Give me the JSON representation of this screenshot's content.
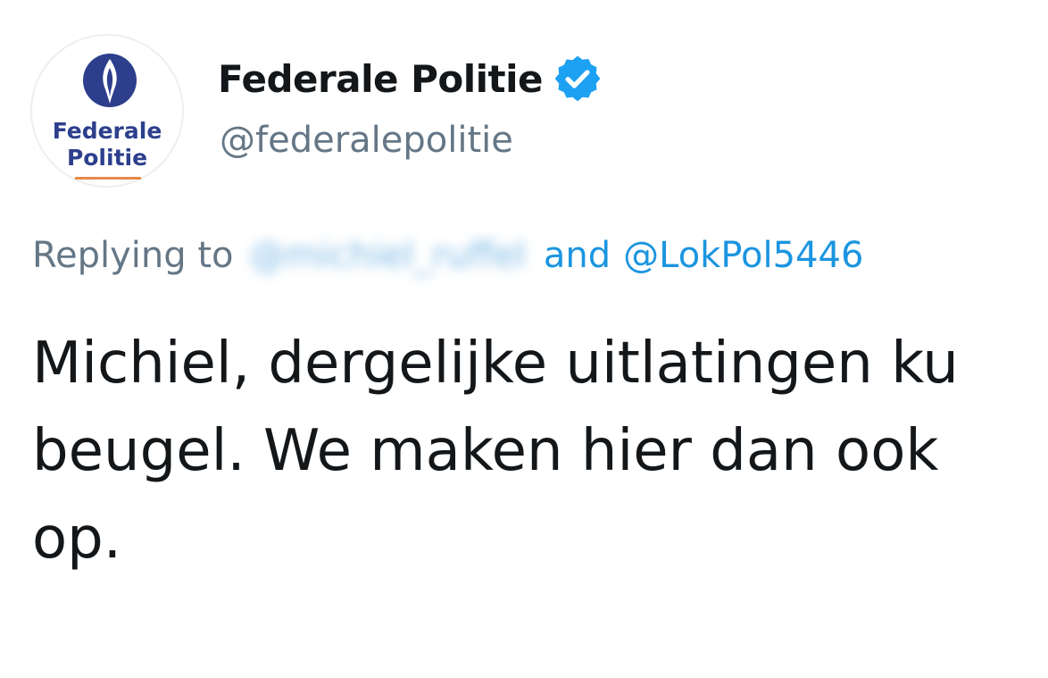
{
  "account": {
    "avatar_text_line1": "Federale",
    "avatar_text_line2": "Politie",
    "display_name": "Federale Politie",
    "handle": "@federalepolitie",
    "verified": true
  },
  "reply": {
    "prefix": "Replying to",
    "blurred_mention": "@michiel_ruffel",
    "conjunction": "and",
    "mention": "@LokPol5446"
  },
  "tweet": {
    "lines": [
      "Michiel, dergelijke uitlatingen ku",
      "beugel. We maken hier dan ook",
      "op."
    ]
  },
  "colors": {
    "text": "#14171a",
    "secondary": "#657786",
    "link": "#1b95e0",
    "verified": "#1da1f2",
    "logo_blue": "#2d3f8c"
  }
}
